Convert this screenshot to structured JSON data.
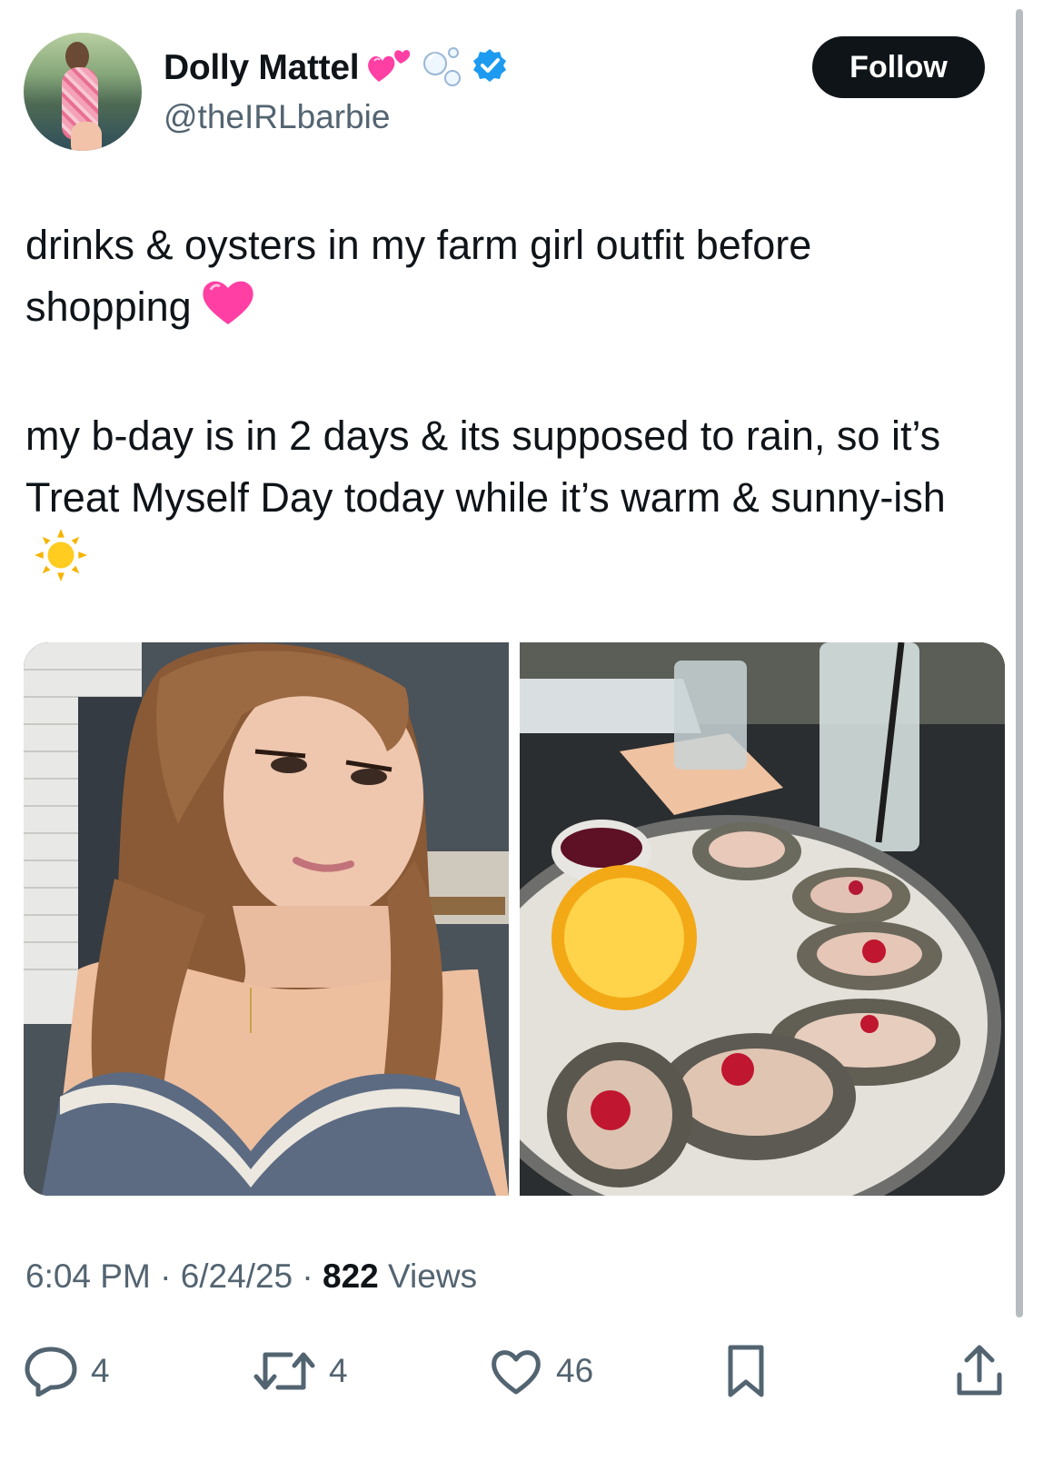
{
  "author": {
    "display_name": "Dolly Mattel",
    "handle": "@theIRLbarbie",
    "badges": [
      "two-hearts-icon",
      "bubbles-icon",
      "verified-badge-icon"
    ],
    "verified_color": "#1d9bf0"
  },
  "follow_button": {
    "label": "Follow"
  },
  "tweet": {
    "paragraph_1": "drinks & oysters in my farm girl outfit before shopping",
    "paragraph_1_emoji": "pink-heart-icon",
    "paragraph_2": "my b-day is in 2 days & its supposed to rain, so it’s Treat Myself Day today while it’s warm & sunny-ish",
    "paragraph_2_emoji": "sun-icon"
  },
  "media": [
    {
      "kind": "photo",
      "subject": "selfie-photo"
    },
    {
      "kind": "photo",
      "subject": "oysters-photo"
    }
  ],
  "meta": {
    "time": "6:04 PM",
    "sep": "·",
    "date": "6/24/25",
    "views_count": "822",
    "views_label": "Views"
  },
  "actions": {
    "replies": "4",
    "reposts": "4",
    "likes": "46"
  },
  "colors": {
    "text": "#0f1419",
    "secondary": "#536471",
    "follow_bg": "#0f1419",
    "heart_pink": "#ff3fa4"
  }
}
